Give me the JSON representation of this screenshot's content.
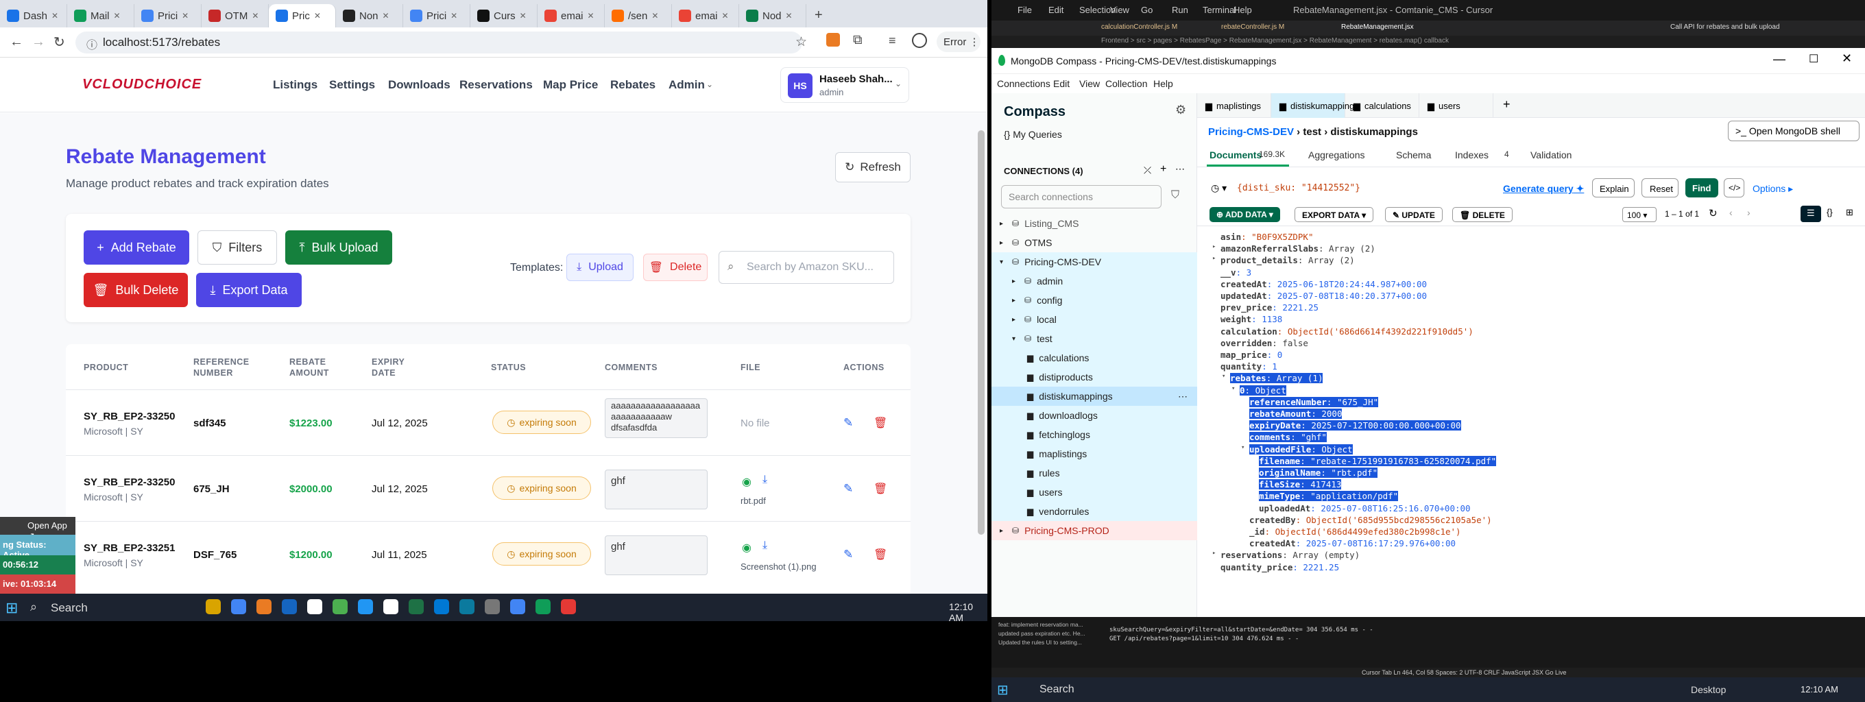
{
  "browser": {
    "tabs": [
      "Dash",
      "Mail",
      "Prici",
      "OTM",
      "Pric",
      "Non",
      "Prici",
      "Curs",
      "emai",
      "/sen",
      "emai",
      "Nod"
    ],
    "url": "localhost:5173/rebates",
    "error": "Error"
  },
  "app": {
    "logo": "VCLOUDCHOICE",
    "menu": [
      "Listings",
      "Settings",
      "Downloads",
      "Reservations",
      "Map Price",
      "Rebates",
      "Admin"
    ],
    "user_initials": "HS",
    "user_name": "Haseeb Shah...",
    "user_role": "admin"
  },
  "page": {
    "title": "Rebate Management",
    "subtitle": "Manage product rebates and track expiration dates",
    "refresh": "Refresh",
    "add": "Add Rebate",
    "filters": "Filters",
    "bulk_upload": "Bulk Upload",
    "bulk_delete": "Bulk Delete",
    "export": "Export Data",
    "templates": "Templates:",
    "tpl_upload": "Upload",
    "tpl_delete": "Delete",
    "search_placeholder": "Search by Amazon SKU..."
  },
  "table": {
    "headers": [
      "PRODUCT",
      "REFERENCE\nNUMBER",
      "REBATE\nAMOUNT",
      "EXPIRY\nDATE",
      "STATUS",
      "COMMENTS",
      "FILE",
      "ACTIONS"
    ],
    "rows": [
      {
        "product": "SY_RB_EP2-33250",
        "brand": "Microsoft | SY",
        "ref": "sdf345",
        "amount": "$1223.00",
        "expiry": "Jul 12, 2025",
        "status": "expiring soon",
        "comment": "aaaaaaaaaaaaaaaaaaaaaaaaaaaaaw\ndfsafasdfda",
        "file": "No file"
      },
      {
        "product": "SY_RB_EP2-33250",
        "brand": "Microsoft | SY",
        "ref": "675_JH",
        "amount": "$2000.00",
        "expiry": "Jul 12, 2025",
        "status": "expiring soon",
        "comment": "ghf",
        "file": "rbt.pdf"
      },
      {
        "product": "SY_RB_EP2-33251",
        "brand": "Microsoft | SY",
        "ref": "DSF_765",
        "amount": "$1200.00",
        "expiry": "Jul 11, 2025",
        "status": "expiring soon",
        "comment": "ghf",
        "file": "Screenshot (1).png"
      }
    ]
  },
  "overlay": {
    "open_app": "Open App",
    "status": "ng Status: Active",
    "t1": "00:56:12",
    "t2": "ive: 01:03:14"
  },
  "taskbar": {
    "search": "Search",
    "time": "12:10 AM"
  },
  "editor": {
    "menu": [
      "File",
      "Edit",
      "Selection",
      "View",
      "Go",
      "Run",
      "Terminal",
      "Help"
    ],
    "title": "RebateManagement.jsx - Comtanie_CMS - Cursor",
    "tabs": [
      "calculationController.js M",
      "rebateController.js M",
      "RebateManagement.jsx"
    ],
    "breadcrumb": "Frontend > src > pages > RebatesPage > RebateManagement.jsx > RebateManagement > rebates.map() callback",
    "chat_title": "Call API for rebates and bulk upload"
  },
  "compass": {
    "title": "MongoDB Compass - Pricing-CMS-DEV/test.distiskumappings",
    "menu": [
      "Connections",
      "Edit",
      "View",
      "Collection",
      "Help"
    ],
    "brand": "Compass",
    "queries": "My Queries",
    "connections": "CONNECTIONS (4)",
    "search_conn": "Search connections",
    "tree": [
      "Listing_CMS",
      "OTMS",
      "Pricing-CMS-DEV",
      "admin",
      "config",
      "local",
      "test",
      "calculations",
      "distiproducts",
      "distiskumappings",
      "downloadlogs",
      "fetchinglogs",
      "maplistings",
      "rules",
      "users",
      "vendorrules",
      "Pricing-CMS-PROD"
    ],
    "coll_tabs": [
      "maplistings",
      "distiskumappings",
      "calculations",
      "users"
    ],
    "crumb": [
      "Pricing-CMS-DEV",
      "test",
      "distiskumappings"
    ],
    "shell": "Open MongoDB shell",
    "sub_tabs": [
      "Documents",
      "169.3K",
      "Aggregations",
      "Schema",
      "Indexes",
      "4",
      "Validation"
    ],
    "query": "{disti_sku: \"14412552\"}",
    "gen_query": "Generate query",
    "explain": "Explain",
    "reset": "Reset",
    "find": "Find",
    "options": "Options",
    "add_data": "ADD DATA",
    "export_data": "EXPORT DATA",
    "update": "UPDATE",
    "delete": "DELETE",
    "page_size": "100",
    "range": "1 – 1 of 1",
    "doc": [
      [
        "asin",
        ": \"B0F9X5ZDPK\"",
        "s",
        0
      ],
      [
        "amazonReferralSlabs",
        ": Array (2)",
        "k",
        0
      ],
      [
        "product_details",
        ": Array (2)",
        "k",
        0
      ],
      [
        "__v",
        ": 3",
        "n",
        0
      ],
      [
        "createdAt",
        ": 2025-06-18T20:24:44.987+00:00",
        "n",
        0
      ],
      [
        "updatedAt",
        ": 2025-07-08T18:40:20.377+00:00",
        "n",
        0
      ],
      [
        "prev_price",
        ": 2221.25",
        "n",
        0
      ],
      [
        "weight",
        ": 1138",
        "n",
        0
      ],
      [
        "calculation",
        ": ObjectId('686d6614f4392d221f910dd5')",
        "s",
        0
      ],
      [
        "overridden",
        ": false",
        "k",
        0
      ],
      [
        "map_price",
        ": 0",
        "n",
        0
      ],
      [
        "quantity",
        ": 1",
        "n",
        0
      ],
      [
        "rebates",
        ": Array (1)",
        "k",
        1
      ],
      [
        "0",
        ": Object",
        "k",
        2
      ],
      [
        "referenceNumber",
        ": \"675_JH\"",
        "s",
        3
      ],
      [
        "rebateAmount",
        ": 2000",
        "n",
        3
      ],
      [
        "expiryDate",
        ": 2025-07-12T00:00:00.000+00:00",
        "n",
        3
      ],
      [
        "comments",
        ": \"ghf\"",
        "s",
        3
      ],
      [
        "uploadedFile",
        ": Object",
        "k",
        3
      ],
      [
        "filename",
        ": \"rebate-1751991916783-625820074.pdf\"",
        "s",
        4
      ],
      [
        "originalName",
        ": \"rbt.pdf\"",
        "s",
        4
      ],
      [
        "fileSize",
        ": 417413",
        "n",
        4
      ],
      [
        "mimeType",
        ": \"application/pdf\"",
        "s",
        4
      ],
      [
        "uploadedAt",
        ": 2025-07-08T16:25:16.070+00:00",
        "n",
        4
      ],
      [
        "createdBy",
        ": ObjectId('685d955bcd298556c2105a5e')",
        "s",
        3
      ],
      [
        "_id",
        ": ObjectId('686d4499efed380c2b998c1e')",
        "s",
        3
      ],
      [
        "createdAt",
        ": 2025-07-08T16:17:29.976+00:00",
        "n",
        3
      ],
      [
        "reservations",
        ": Array (empty)",
        "k",
        0
      ],
      [
        "quantity_price",
        ": 2221.25",
        "n",
        0
      ]
    ]
  },
  "terminal": [
    "feat: implement reservation ma...",
    "updated pass expiration etc. He...",
    "Updated the rules UI to setting..."
  ],
  "terminal_log": [
    "skuSearchQuery=&expiryFilter=all&startDate=&endDate= 304 356.654 ms - -",
    "GET /api/rebates?page=1&limit=10 304 476.624 ms - -"
  ],
  "statusbar": "Cursor Tab  Ln 464, Col 58  Spaces: 2  UTF-8  CRLF  JavaScript JSX  Go Live",
  "taskbar2": {
    "search": "Search",
    "desktop": "Desktop",
    "time": "12:10 AM"
  }
}
